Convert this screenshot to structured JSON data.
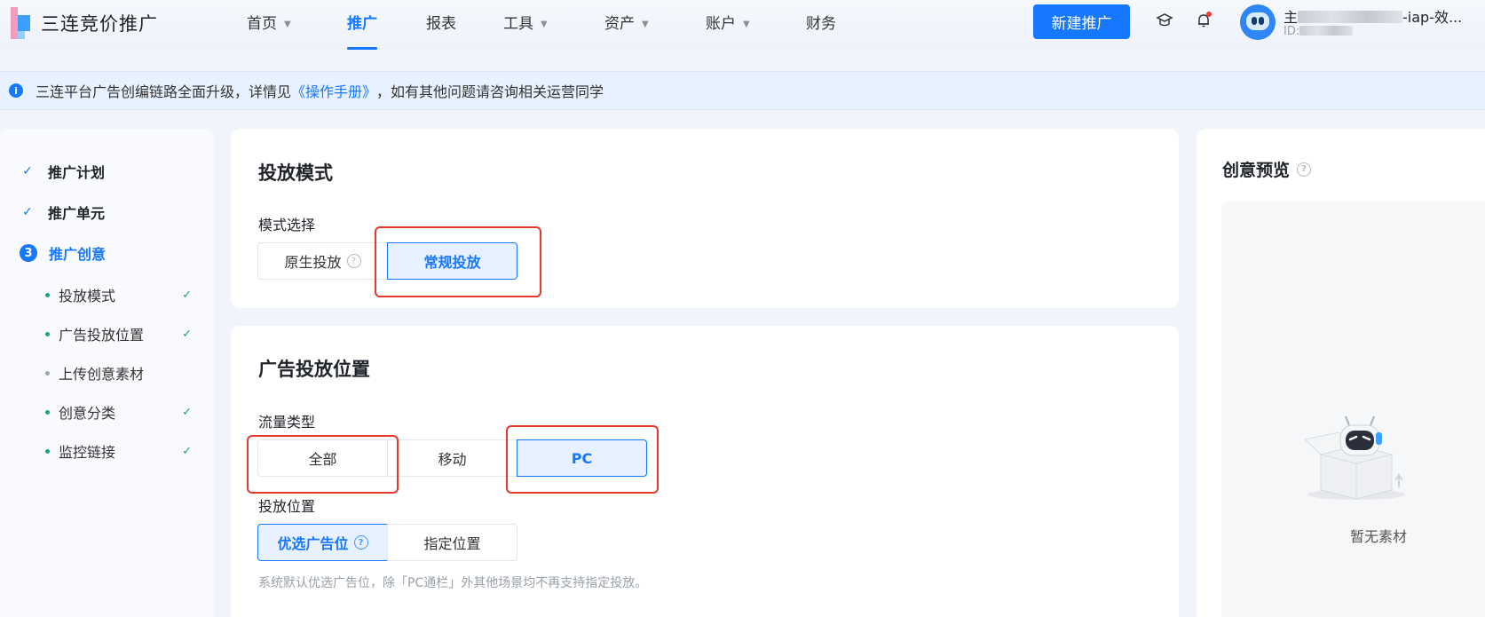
{
  "brand": {
    "name": "三连竞价推广"
  },
  "nav": [
    {
      "label": "首页",
      "caret": true
    },
    {
      "label": "推广",
      "caret": false,
      "active": true
    },
    {
      "label": "报表",
      "caret": false
    },
    {
      "label": "工具",
      "caret": true
    },
    {
      "label": "资产",
      "caret": true
    },
    {
      "label": "账户",
      "caret": true
    },
    {
      "label": "财务",
      "caret": false
    }
  ],
  "header": {
    "new_button": "新建推广",
    "account_prefix": "主",
    "account_suffix": "-iap-效...",
    "id_label": "ID:"
  },
  "notice": {
    "before": "三连平台广告创编链路全面升级，详情见",
    "link": "《操作手册》",
    "after": "，如有其他问题请咨询相关运营同学"
  },
  "steps": {
    "plan": "推广计划",
    "unit": "推广单元",
    "creative_num": "3",
    "creative": "推广创意",
    "subs": [
      {
        "label": "投放模式",
        "done": true
      },
      {
        "label": "广告投放位置",
        "done": true
      },
      {
        "label": "上传创意素材",
        "done": false
      },
      {
        "label": "创意分类",
        "done": true
      },
      {
        "label": "监控链接",
        "done": true
      }
    ]
  },
  "mode_card": {
    "title": "投放模式",
    "field_label": "模式选择",
    "options": [
      "原生投放",
      "常规投放"
    ],
    "selected": "常规投放"
  },
  "placement_card": {
    "title": "广告投放位置",
    "traffic_label": "流量类型",
    "traffic_options": [
      "全部",
      "移动",
      "PC"
    ],
    "traffic_selected": "PC",
    "position_label": "投放位置",
    "position_options": [
      "优选广告位",
      "指定位置"
    ],
    "position_selected": "优选广告位",
    "hint": "系统默认优选广告位，除「PC通栏」外其他场景均不再支持指定投放。"
  },
  "preview": {
    "title": "创意预览",
    "empty": "暂无素材"
  },
  "colors": {
    "primary": "#1677ff",
    "annotation": "#e8372d",
    "success": "#17a673"
  }
}
